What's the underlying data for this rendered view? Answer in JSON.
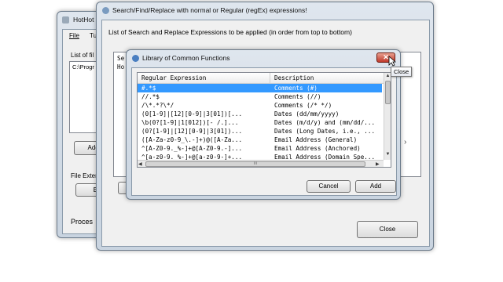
{
  "hothot": {
    "title": "HotHot",
    "menu": [
      "File",
      "Tu"
    ],
    "list_label": "List of fil",
    "path_value": "C:\\Progr",
    "add_button": "Add Fil",
    "file_ext_label": "File Exter",
    "browse_button": "Bro",
    "process_label": "Proces"
  },
  "search_dialog": {
    "title": "Search/Find/Replace with normal or Regular (regEx) expressions!",
    "description": "List of Search and Replace Expressions to be applied (in order from top to bottom)",
    "list_header": "Se",
    "list_row": "Ho",
    "add_button_partial": "Ad",
    "close_button": "Close"
  },
  "library_dialog": {
    "title": "Library of Common Functions",
    "close_tooltip": "Close",
    "columns": [
      "Regular Expression",
      "Description"
    ],
    "rows": [
      {
        "expr": "#.*$",
        "desc": "Comments (#)",
        "selected": true
      },
      {
        "expr": "//.*$",
        "desc": "Comments (//)",
        "selected": false
      },
      {
        "expr": "/\\*.*?\\*/",
        "desc": "Comments (/* */)",
        "selected": false
      },
      {
        "expr": "(0[1-9]|[12][0-9]|3[01])[...",
        "desc": "Dates (dd/mm/yyyy)",
        "selected": false
      },
      {
        "expr": "\\b(0?[1-9]|1[012])[- /.]...",
        "desc": "Dates (m/d/y) and (mm/dd/...",
        "selected": false
      },
      {
        "expr": "(0?[1-9]|[12][0-9]|3[01])...",
        "desc": "Dates (Long Dates, i.e., ...",
        "selected": false
      },
      {
        "expr": "([A-Za-z0-9_\\.-]+)@([A-Za...",
        "desc": "Email Address (General)",
        "selected": false
      },
      {
        "expr": "^[A-Z0-9._%-]+@[A-Z0-9.-]...",
        "desc": "Email Address (Anchored)",
        "selected": false
      },
      {
        "expr": "^[a-z0-9._%-]+@[a-z0-9-]+...",
        "desc": "Email Address (Domain Spe...",
        "selected": false
      }
    ],
    "scroll_thumb_glyph": "III",
    "cancel_button": "Cancel",
    "add_button": "Add"
  },
  "colors": {
    "selection": "#3399ff",
    "close_red": "#c0392b"
  }
}
